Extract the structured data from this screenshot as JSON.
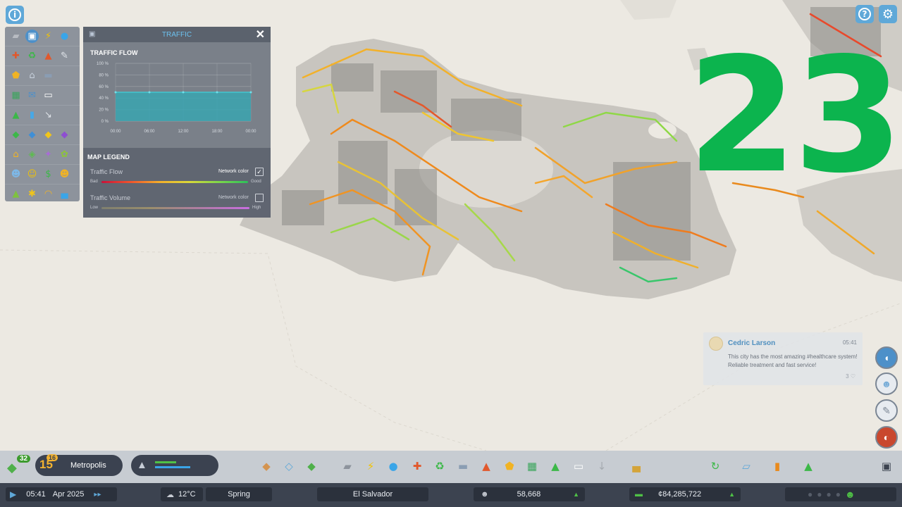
{
  "overlay_number": "23",
  "traffic_panel": {
    "title": "TRAFFIC",
    "flow_section": "TRAFFIC FLOW",
    "y_ticks": [
      "100 %",
      "80 %",
      "60 %",
      "40 %",
      "20 %",
      "0 %"
    ],
    "x_ticks": [
      "00:00",
      "06:00",
      "12:00",
      "18:00",
      "00:00"
    ],
    "flow_value": 0.5,
    "legend_title": "MAP LEGEND",
    "traffic_flow_label": "Traffic Flow",
    "traffic_flow_network": "Network color",
    "flow_bad": "Bad",
    "flow_good": "Good",
    "traffic_volume_label": "Traffic Volume",
    "traffic_volume_network": "Network color",
    "volume_low": "Low",
    "volume_high": "High"
  },
  "chirp": {
    "name": "Cedric Larson",
    "time": "05:41",
    "message": "This city has the most amazing #healthcare system! Reliable treatment and fast service!",
    "likes": "3"
  },
  "toolbar": {
    "milestone_badge": "32",
    "level_badge": "16",
    "level_number": "15",
    "milestone_name": "Metropolis"
  },
  "status": {
    "time": "05:41",
    "date": "Apr 2025",
    "temperature": "12°C",
    "season": "Spring",
    "city_name": "El Salvador",
    "population": "58,668",
    "money": "¢84,285,722"
  },
  "colors": {
    "accent_blue": "#5fa8d8",
    "overlay_green": "#0cb44e"
  }
}
